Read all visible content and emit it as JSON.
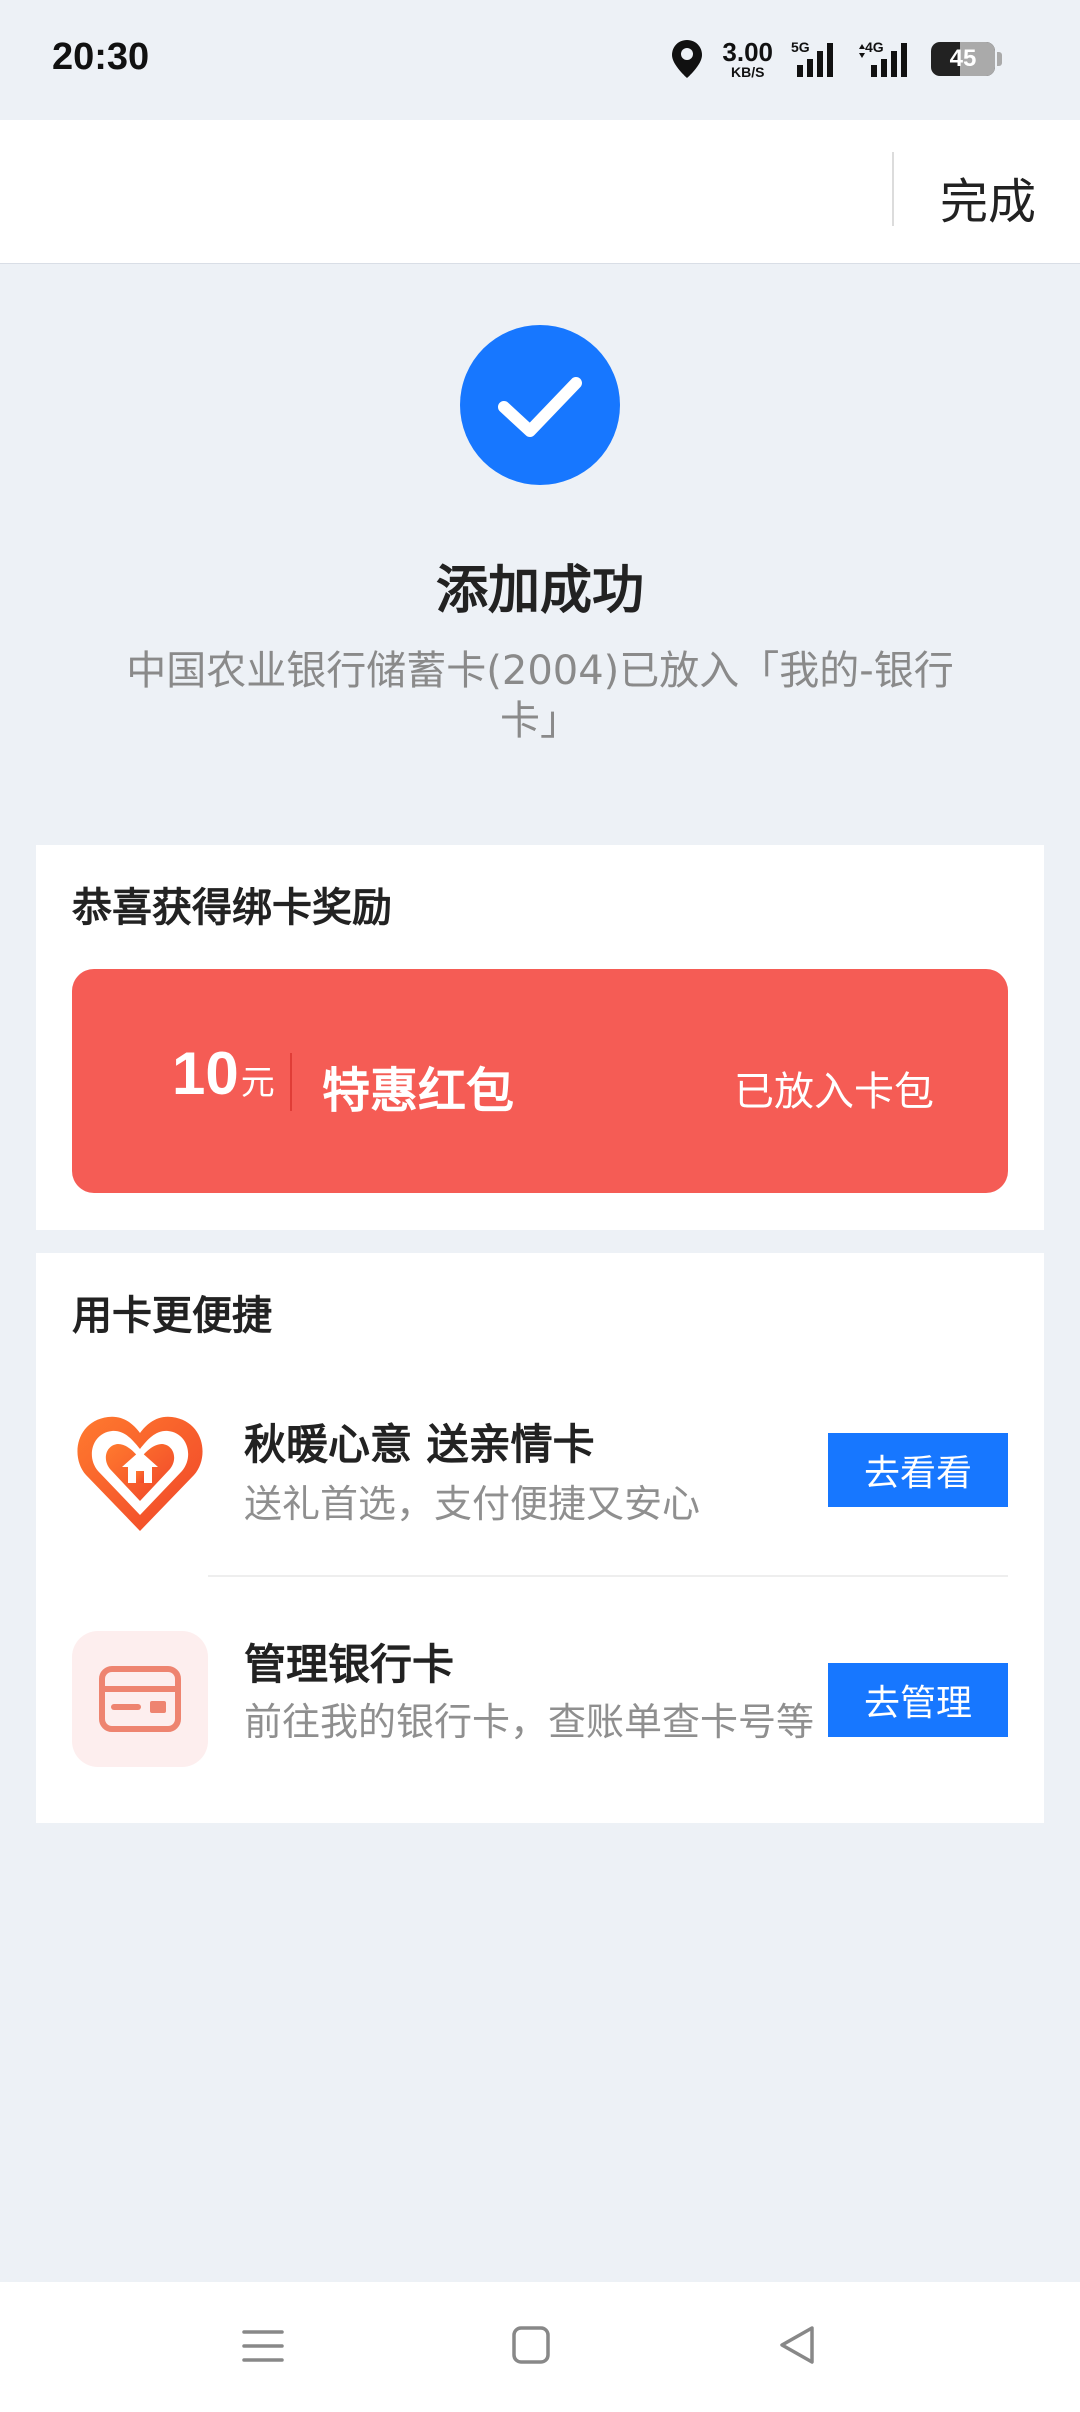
{
  "status_bar": {
    "time": "20:30",
    "network_speed": "3.00",
    "network_speed_unit": "KB/S",
    "signal_1_label": "5G",
    "signal_2_label": "4G",
    "battery": "45",
    "battery_level": 0.45
  },
  "header": {
    "done_label": "完成"
  },
  "success": {
    "title": "添加成功",
    "description": "中国农业银行储蓄卡(2004)已放入「我的-银行卡」"
  },
  "reward": {
    "section_title": "恭喜获得绑卡奖励",
    "amount": "10",
    "amount_unit": "元",
    "name": "特惠红包",
    "status": "已放入卡包"
  },
  "quick": {
    "section_title": "用卡更便捷",
    "items": [
      {
        "title": "秋暖心意 送亲情卡",
        "description": "送礼首选，支付便捷又安心",
        "button": "去看看"
      },
      {
        "title": "管理银行卡",
        "description": "前往我的银行卡，查账单查卡号等",
        "button": "去管理"
      }
    ]
  },
  "colors": {
    "accent": "#1777ff",
    "reward_red": "#f55c55",
    "background": "#edf1f6"
  }
}
